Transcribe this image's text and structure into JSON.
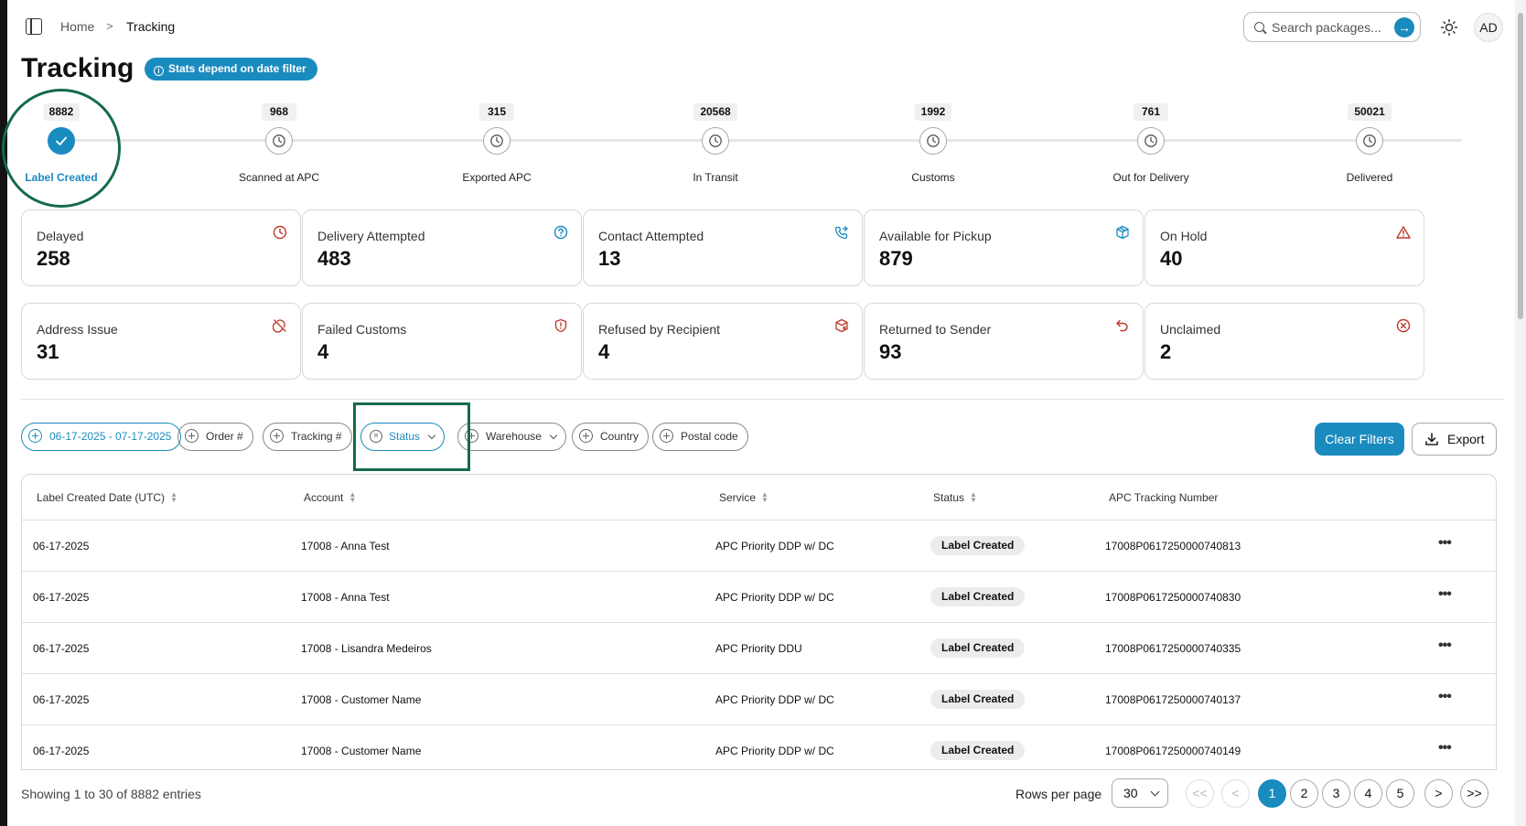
{
  "breadcrumb": {
    "home": "Home",
    "separator": ">",
    "current": "Tracking"
  },
  "search": {
    "placeholder": "Search packages..."
  },
  "user": {
    "initials": "AD"
  },
  "page": {
    "title": "Tracking",
    "stats_note": "Stats depend on date filter"
  },
  "stepper": [
    {
      "count": "8882",
      "label": "Label Created",
      "active": true
    },
    {
      "count": "968",
      "label": "Scanned at APC",
      "active": false
    },
    {
      "count": "315",
      "label": "Exported APC",
      "active": false
    },
    {
      "count": "20568",
      "label": "In Transit",
      "active": false
    },
    {
      "count": "1992",
      "label": "Customs",
      "active": false
    },
    {
      "count": "761",
      "label": "Out for Delivery",
      "active": false
    },
    {
      "count": "50021",
      "label": "Delivered",
      "active": false
    }
  ],
  "cards": [
    {
      "title": "Delayed",
      "value": "258",
      "icon": "clock-icon",
      "icon_color": "#c0392b"
    },
    {
      "title": "Delivery Attempted",
      "value": "483",
      "icon": "help-circle-icon",
      "icon_color": "#1a8bbf"
    },
    {
      "title": "Contact Attempted",
      "value": "13",
      "icon": "phone-forward-icon",
      "icon_color": "#1a8bbf"
    },
    {
      "title": "Available for Pickup",
      "value": "879",
      "icon": "package-icon",
      "icon_color": "#1a8bbf"
    },
    {
      "title": "On Hold",
      "value": "40",
      "icon": "alert-triangle-icon",
      "icon_color": "#c0392b"
    },
    {
      "title": "Address Issue",
      "value": "31",
      "icon": "map-pin-off-icon",
      "icon_color": "#c0392b"
    },
    {
      "title": "Failed Customs",
      "value": "4",
      "icon": "shield-alert-icon",
      "icon_color": "#c0392b"
    },
    {
      "title": "Refused by Recipient",
      "value": "4",
      "icon": "package-x-icon",
      "icon_color": "#c0392b"
    },
    {
      "title": "Returned to Sender",
      "value": "93",
      "icon": "undo-icon",
      "icon_color": "#c0392b"
    },
    {
      "title": "Unclaimed",
      "value": "2",
      "icon": "x-circle-icon",
      "icon_color": "#c0392b"
    }
  ],
  "filters": {
    "date_range": "06-17-2025 - 07-17-2025",
    "order": "Order #",
    "tracking": "Tracking #",
    "status": "Status",
    "warehouse": "Warehouse",
    "country": "Country",
    "postal": "Postal code",
    "clear": "Clear Filters",
    "export": "Export"
  },
  "table": {
    "columns": [
      "Label Created Date (UTC)",
      "Account",
      "Service",
      "Status",
      "APC Tracking Number"
    ],
    "rows": [
      {
        "date": "06-17-2025",
        "account": "17008 - Anna Test",
        "service": "APC Priority DDP w/ DC",
        "status": "Label Created",
        "tracking": "17008P0617250000740813"
      },
      {
        "date": "06-17-2025",
        "account": "17008 - Anna Test",
        "service": "APC Priority DDP w/ DC",
        "status": "Label Created",
        "tracking": "17008P0617250000740830"
      },
      {
        "date": "06-17-2025",
        "account": "17008 - Lisandra Medeiros",
        "service": "APC Priority DDU",
        "status": "Label Created",
        "tracking": "17008P0617250000740335"
      },
      {
        "date": "06-17-2025",
        "account": "17008 - Customer Name",
        "service": "APC Priority DDP w/ DC",
        "status": "Label Created",
        "tracking": "17008P0617250000740137"
      },
      {
        "date": "06-17-2025",
        "account": "17008 - Customer Name",
        "service": "APC Priority DDP w/ DC",
        "status": "Label Created",
        "tracking": "17008P0617250000740149"
      }
    ]
  },
  "pagination": {
    "info": "Showing 1 to 30 of 8882 entries",
    "rows_per_page_label": "Rows per page",
    "rows_per_page": "30",
    "first": "<<",
    "prev": "<",
    "next": ">",
    "last": ">>",
    "pages": [
      "1",
      "2",
      "3",
      "4",
      "5"
    ],
    "current": "1"
  },
  "colors": {
    "accent": "#1a8bbf",
    "danger": "#c0392b",
    "annotation": "#146b4a"
  }
}
